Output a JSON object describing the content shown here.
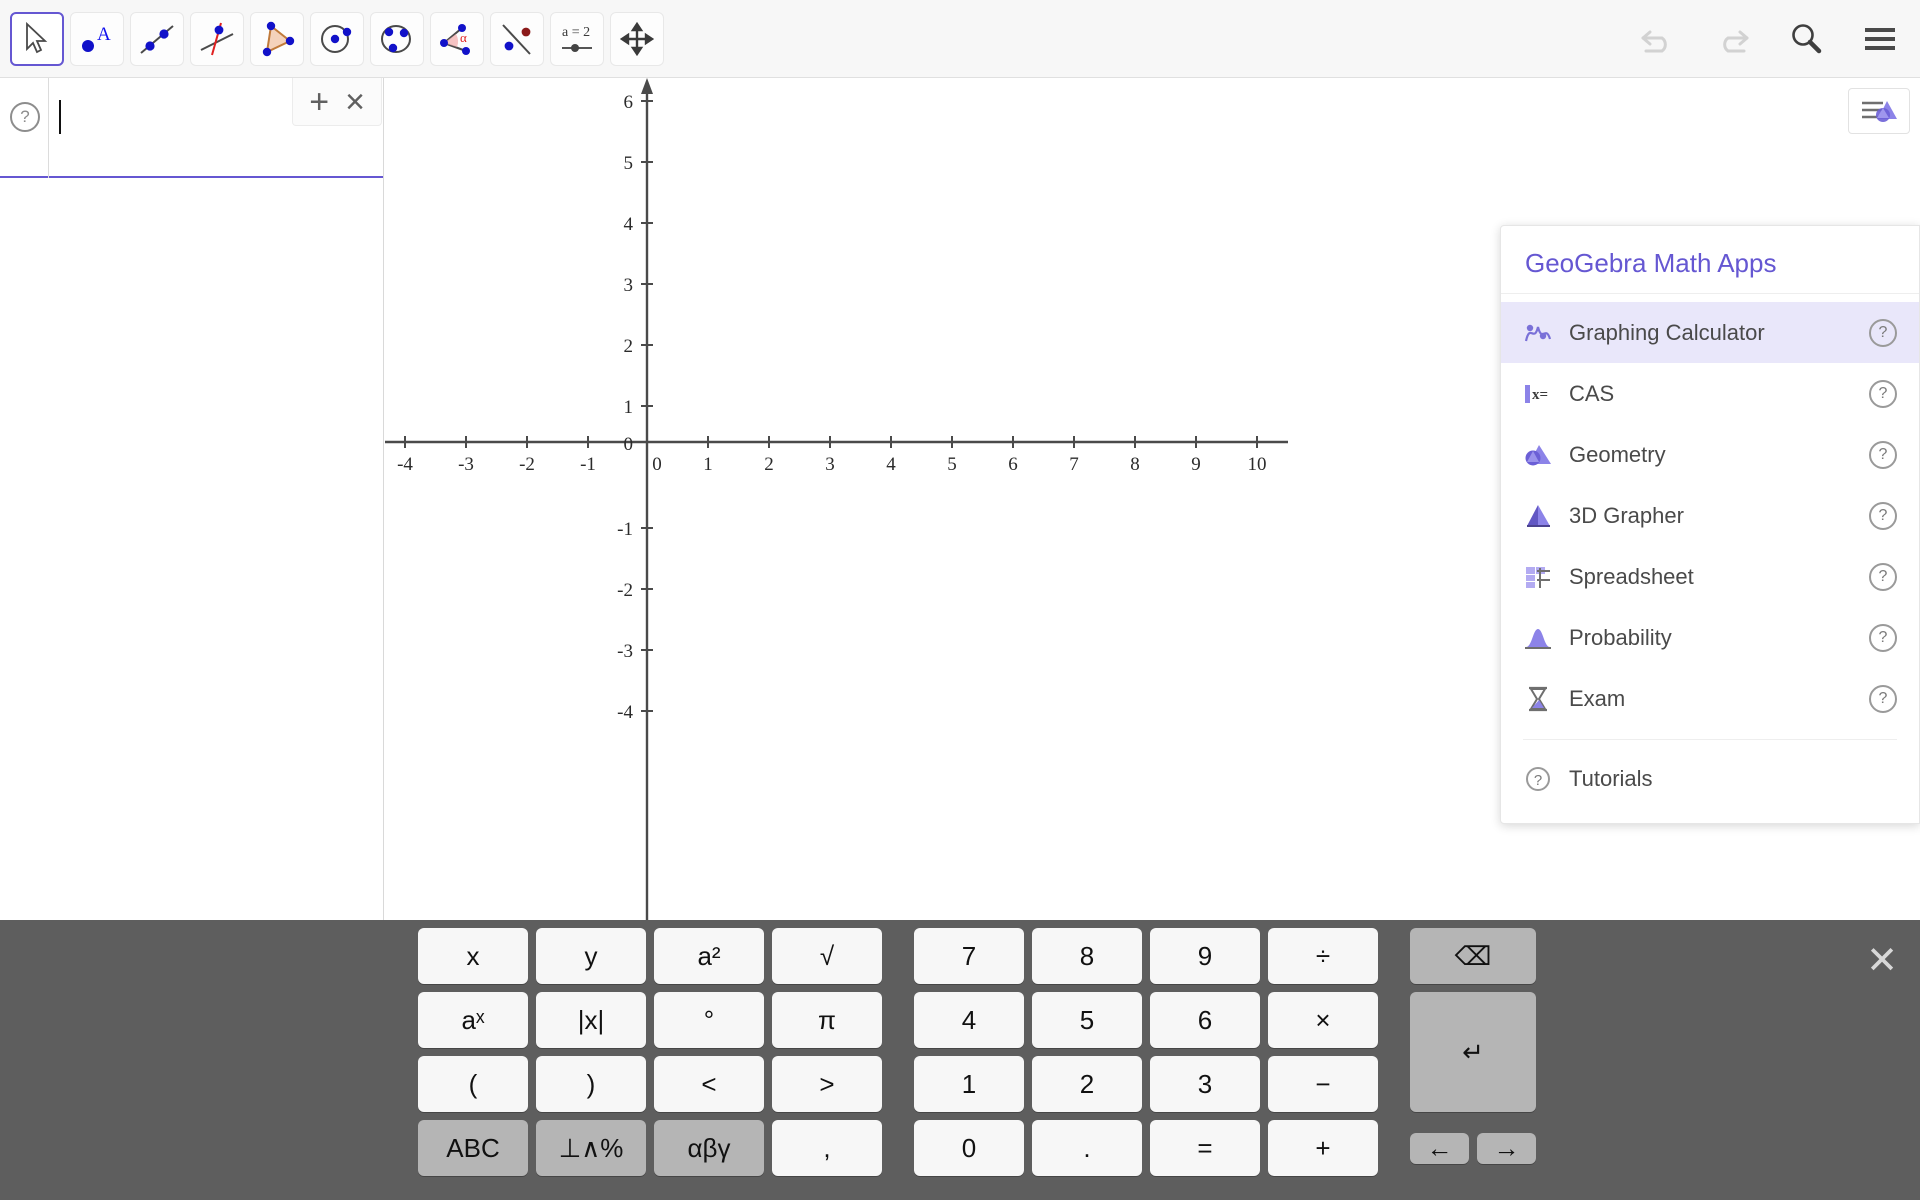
{
  "toolbar": {
    "tools": [
      {
        "name": "move-tool",
        "icon": "arrow-cursor-icon",
        "selected": true
      },
      {
        "name": "point-tool",
        "icon": "point-a-icon",
        "selected": false
      },
      {
        "name": "line-tool",
        "icon": "line-through-two-points-icon",
        "selected": false
      },
      {
        "name": "perpendicular-line-tool",
        "icon": "perpendicular-line-icon",
        "selected": false
      },
      {
        "name": "polygon-tool",
        "icon": "polygon-icon",
        "selected": false
      },
      {
        "name": "circle-tool",
        "icon": "circle-center-point-icon",
        "selected": false
      },
      {
        "name": "ellipse-tool",
        "icon": "ellipse-icon",
        "selected": false
      },
      {
        "name": "angle-tool",
        "icon": "angle-alpha-icon",
        "selected": false
      },
      {
        "name": "reflect-tool",
        "icon": "reflect-about-line-icon",
        "selected": false
      },
      {
        "name": "slider-tool",
        "icon": "slider-a-equals-2-icon",
        "selected": false
      },
      {
        "name": "move-graphics-tool",
        "icon": "move-graphics-view-icon",
        "selected": false
      }
    ],
    "actions": [
      {
        "name": "undo-button",
        "icon": "undo-icon",
        "enabled": false
      },
      {
        "name": "redo-button",
        "icon": "redo-icon",
        "enabled": false
      },
      {
        "name": "search-button",
        "icon": "search-icon",
        "enabled": true
      },
      {
        "name": "menu-button",
        "icon": "hamburger-menu-icon",
        "enabled": true
      }
    ]
  },
  "algebra": {
    "help_label": "?",
    "input_value": "",
    "input_placeholder": "",
    "add_label": "+",
    "close_label": "×"
  },
  "graphics": {
    "style_bar_icon": "graphics-style-bar-icon",
    "chart_data": {
      "type": "line",
      "title": "",
      "xlabel": "",
      "ylabel": "",
      "grid": false,
      "axes": true,
      "xlim": [
        -4.6,
        10.6
      ],
      "ylim": [
        -4.8,
        6.4
      ],
      "x_ticks": [
        -4,
        -3,
        -2,
        -1,
        0,
        1,
        2,
        3,
        4,
        5,
        6,
        7,
        8,
        9,
        10
      ],
      "x_tick_labels": [
        "-4",
        "-3",
        "-2",
        "-1",
        "0",
        "1",
        "2",
        "3",
        "4",
        "5",
        "6",
        "7",
        "8",
        "9",
        "10"
      ],
      "y_ticks": [
        -4,
        -3,
        -2,
        -1,
        0,
        1,
        2,
        3,
        4,
        5,
        6
      ],
      "y_tick_labels": [
        "-4",
        "-3",
        "-2",
        "-1",
        "0",
        "1",
        "2",
        "3",
        "4",
        "5",
        "6"
      ],
      "origin_label": "0",
      "series": []
    }
  },
  "apps_panel": {
    "title": "GeoGebra Math Apps",
    "items": [
      {
        "label": "Graphing Calculator",
        "icon": "graphing-calculator-icon",
        "active": true,
        "help": "?"
      },
      {
        "label": "CAS",
        "icon": "cas-icon",
        "active": false,
        "help": "?"
      },
      {
        "label": "Geometry",
        "icon": "geometry-icon",
        "active": false,
        "help": "?"
      },
      {
        "label": "3D Grapher",
        "icon": "3d-grapher-icon",
        "active": false,
        "help": "?"
      },
      {
        "label": "Spreadsheet",
        "icon": "spreadsheet-icon",
        "active": false,
        "help": "?"
      },
      {
        "label": "Probability",
        "icon": "probability-icon",
        "active": false,
        "help": "?"
      },
      {
        "label": "Exam",
        "icon": "exam-icon",
        "active": false,
        "help": "?"
      }
    ],
    "footer": {
      "label": "Tutorials",
      "icon": "question-mark-icon"
    }
  },
  "keyboard": {
    "close_label": "✕",
    "left_keys": [
      {
        "label": "x",
        "style": "light"
      },
      {
        "label": "y",
        "style": "light"
      },
      {
        "label": "a²",
        "style": "light"
      },
      {
        "label": "√",
        "style": "light"
      },
      {
        "label": "aˣ",
        "style": "light"
      },
      {
        "label": "|x|",
        "style": "light"
      },
      {
        "label": "°",
        "style": "light"
      },
      {
        "label": "π",
        "style": "light"
      },
      {
        "label": "(",
        "style": "light"
      },
      {
        "label": ")",
        "style": "light"
      },
      {
        "label": "<",
        "style": "light"
      },
      {
        "label": ">",
        "style": "light"
      },
      {
        "label": "ABC",
        "style": "gray"
      },
      {
        "label": "⊥∧%",
        "style": "gray"
      },
      {
        "label": "αβγ",
        "style": "gray"
      },
      {
        "label": ",",
        "style": "light"
      }
    ],
    "number_keys": [
      {
        "label": "7",
        "style": "light"
      },
      {
        "label": "8",
        "style": "light"
      },
      {
        "label": "9",
        "style": "light"
      },
      {
        "label": "÷",
        "style": "light"
      },
      {
        "label": "4",
        "style": "light"
      },
      {
        "label": "5",
        "style": "light"
      },
      {
        "label": "6",
        "style": "light"
      },
      {
        "label": "×",
        "style": "light"
      },
      {
        "label": "1",
        "style": "light"
      },
      {
        "label": "2",
        "style": "light"
      },
      {
        "label": "3",
        "style": "light"
      },
      {
        "label": "−",
        "style": "light"
      },
      {
        "label": "0",
        "style": "light"
      },
      {
        "label": ".",
        "style": "light"
      },
      {
        "label": "=",
        "style": "light"
      },
      {
        "label": "+",
        "style": "light"
      }
    ],
    "control_keys": {
      "backspace": "⌫",
      "enter": "↵",
      "left_arrow": "←",
      "right_arrow": "→"
    }
  },
  "colors": {
    "accent": "#6557d2",
    "toolbar_bg": "#f7f7f7",
    "keyboard_bg": "#5e5e5e",
    "key_light": "#f7f7f7",
    "key_gray": "#b5b5b5",
    "active_item": "#e9e7fa"
  }
}
